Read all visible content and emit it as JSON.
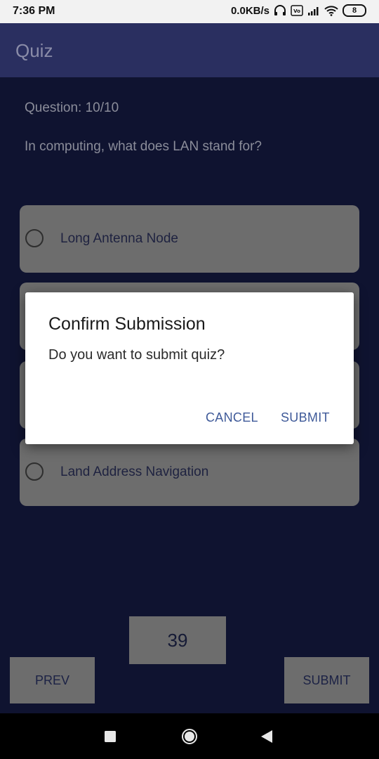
{
  "status_bar": {
    "time": "7:36 PM",
    "net_speed": "0.0KB/s",
    "battery": "8",
    "icons": [
      "headphones-icon",
      "volte-icon",
      "signal-icon",
      "wifi-icon",
      "battery-icon"
    ]
  },
  "app_bar": {
    "title": "Quiz"
  },
  "quiz": {
    "question_count": "Question: 10/10",
    "question_text": "In computing, what does LAN stand for?",
    "options": [
      {
        "label": "Long Antenna Node"
      },
      {
        "label": ""
      },
      {
        "label": ""
      },
      {
        "label": "Land Address Navigation"
      }
    ],
    "timer": "39",
    "prev_label": "PREV",
    "submit_label": "SUBMIT"
  },
  "dialog": {
    "title": "Confirm Submission",
    "message": "Do you want to submit quiz?",
    "cancel_label": "CANCEL",
    "submit_label": "SUBMIT"
  },
  "colors": {
    "background": "#0f1330",
    "app_bar": "#2a2f60",
    "option_card": "#6d6d6d",
    "dialog_button": "#3f5a99"
  }
}
